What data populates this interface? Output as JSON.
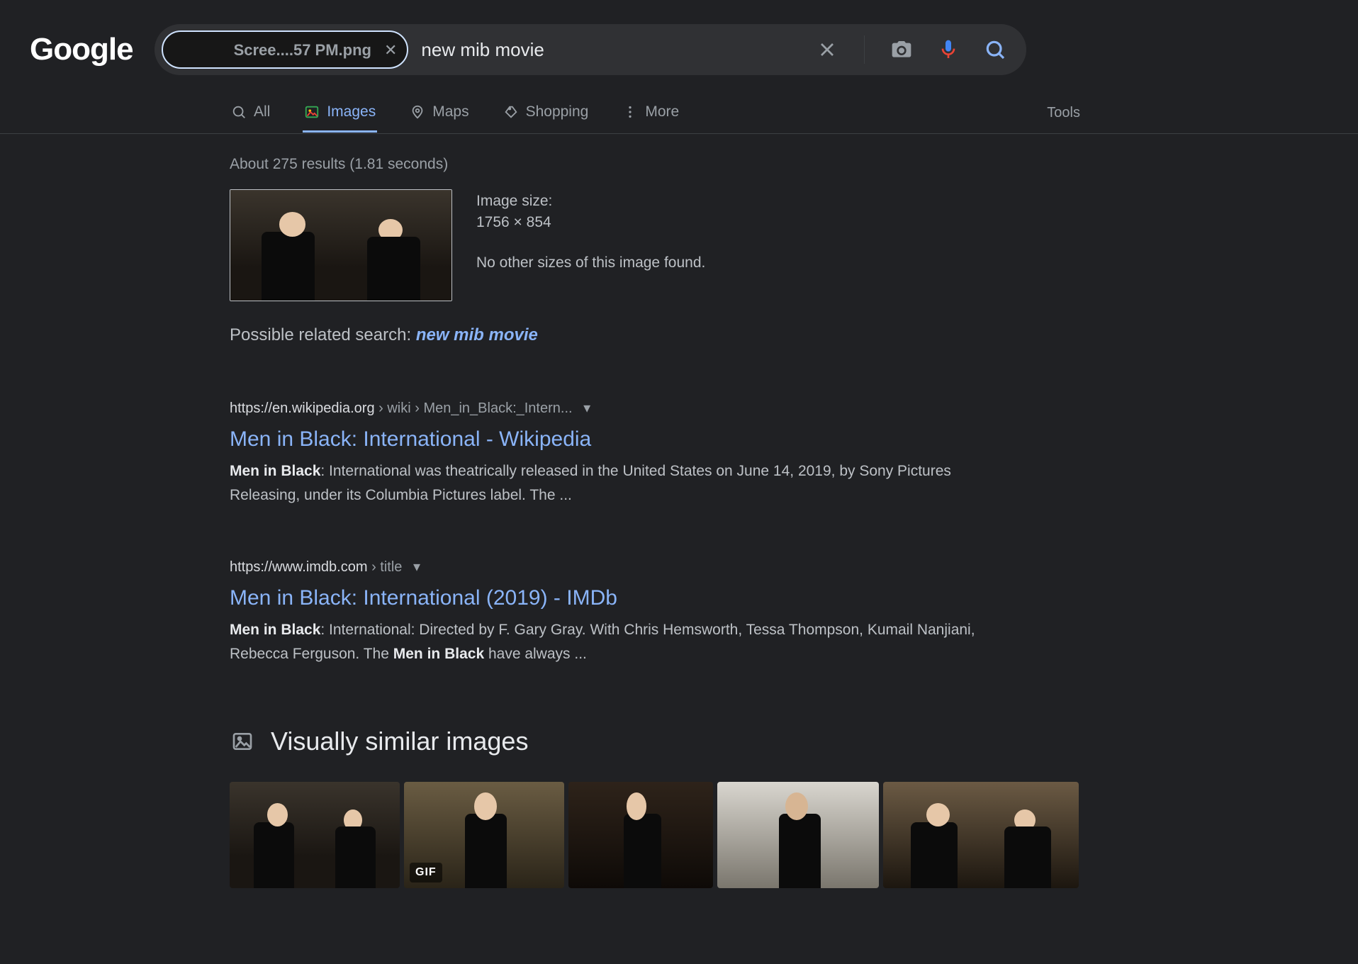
{
  "logo_text": "Google",
  "search": {
    "chip_filename": "Scree....57 PM.png",
    "query": "new mib movie"
  },
  "tabs": {
    "all": "All",
    "images": "Images",
    "maps": "Maps",
    "shopping": "Shopping",
    "more": "More",
    "tools": "Tools"
  },
  "stats": "About 275 results (1.81 seconds)",
  "source_image": {
    "size_label": "Image size:",
    "dimensions": "1756 × 854",
    "no_other_sizes": "No other sizes of this image found."
  },
  "related": {
    "label": "Possible related search: ",
    "link_text": "new mib movie"
  },
  "results": [
    {
      "host": "https://en.wikipedia.org",
      "path": " › wiki › Men_in_Black:_Intern...",
      "title": "Men in Black: International - Wikipedia",
      "snippet_bold_prefix": "Men in Black",
      "snippet_rest": ": International was theatrically released in the United States on June 14, 2019, by Sony Pictures Releasing, under its Columbia Pictures label. The ..."
    },
    {
      "host": "https://www.imdb.com",
      "path": " › title",
      "title": "Men in Black: International (2019) - IMDb",
      "snippet_bold_prefix": "Men in Black",
      "snippet_mid": ": International: Directed by F. Gary Gray. With Chris Hemsworth, Tessa Thompson, Kumail Nanjiani, Rebecca Ferguson. The ",
      "snippet_bold_mid": "Men in Black",
      "snippet_tail": " have always ..."
    }
  ],
  "visually_section_title": "Visually similar images",
  "gif_badge": "GIF"
}
